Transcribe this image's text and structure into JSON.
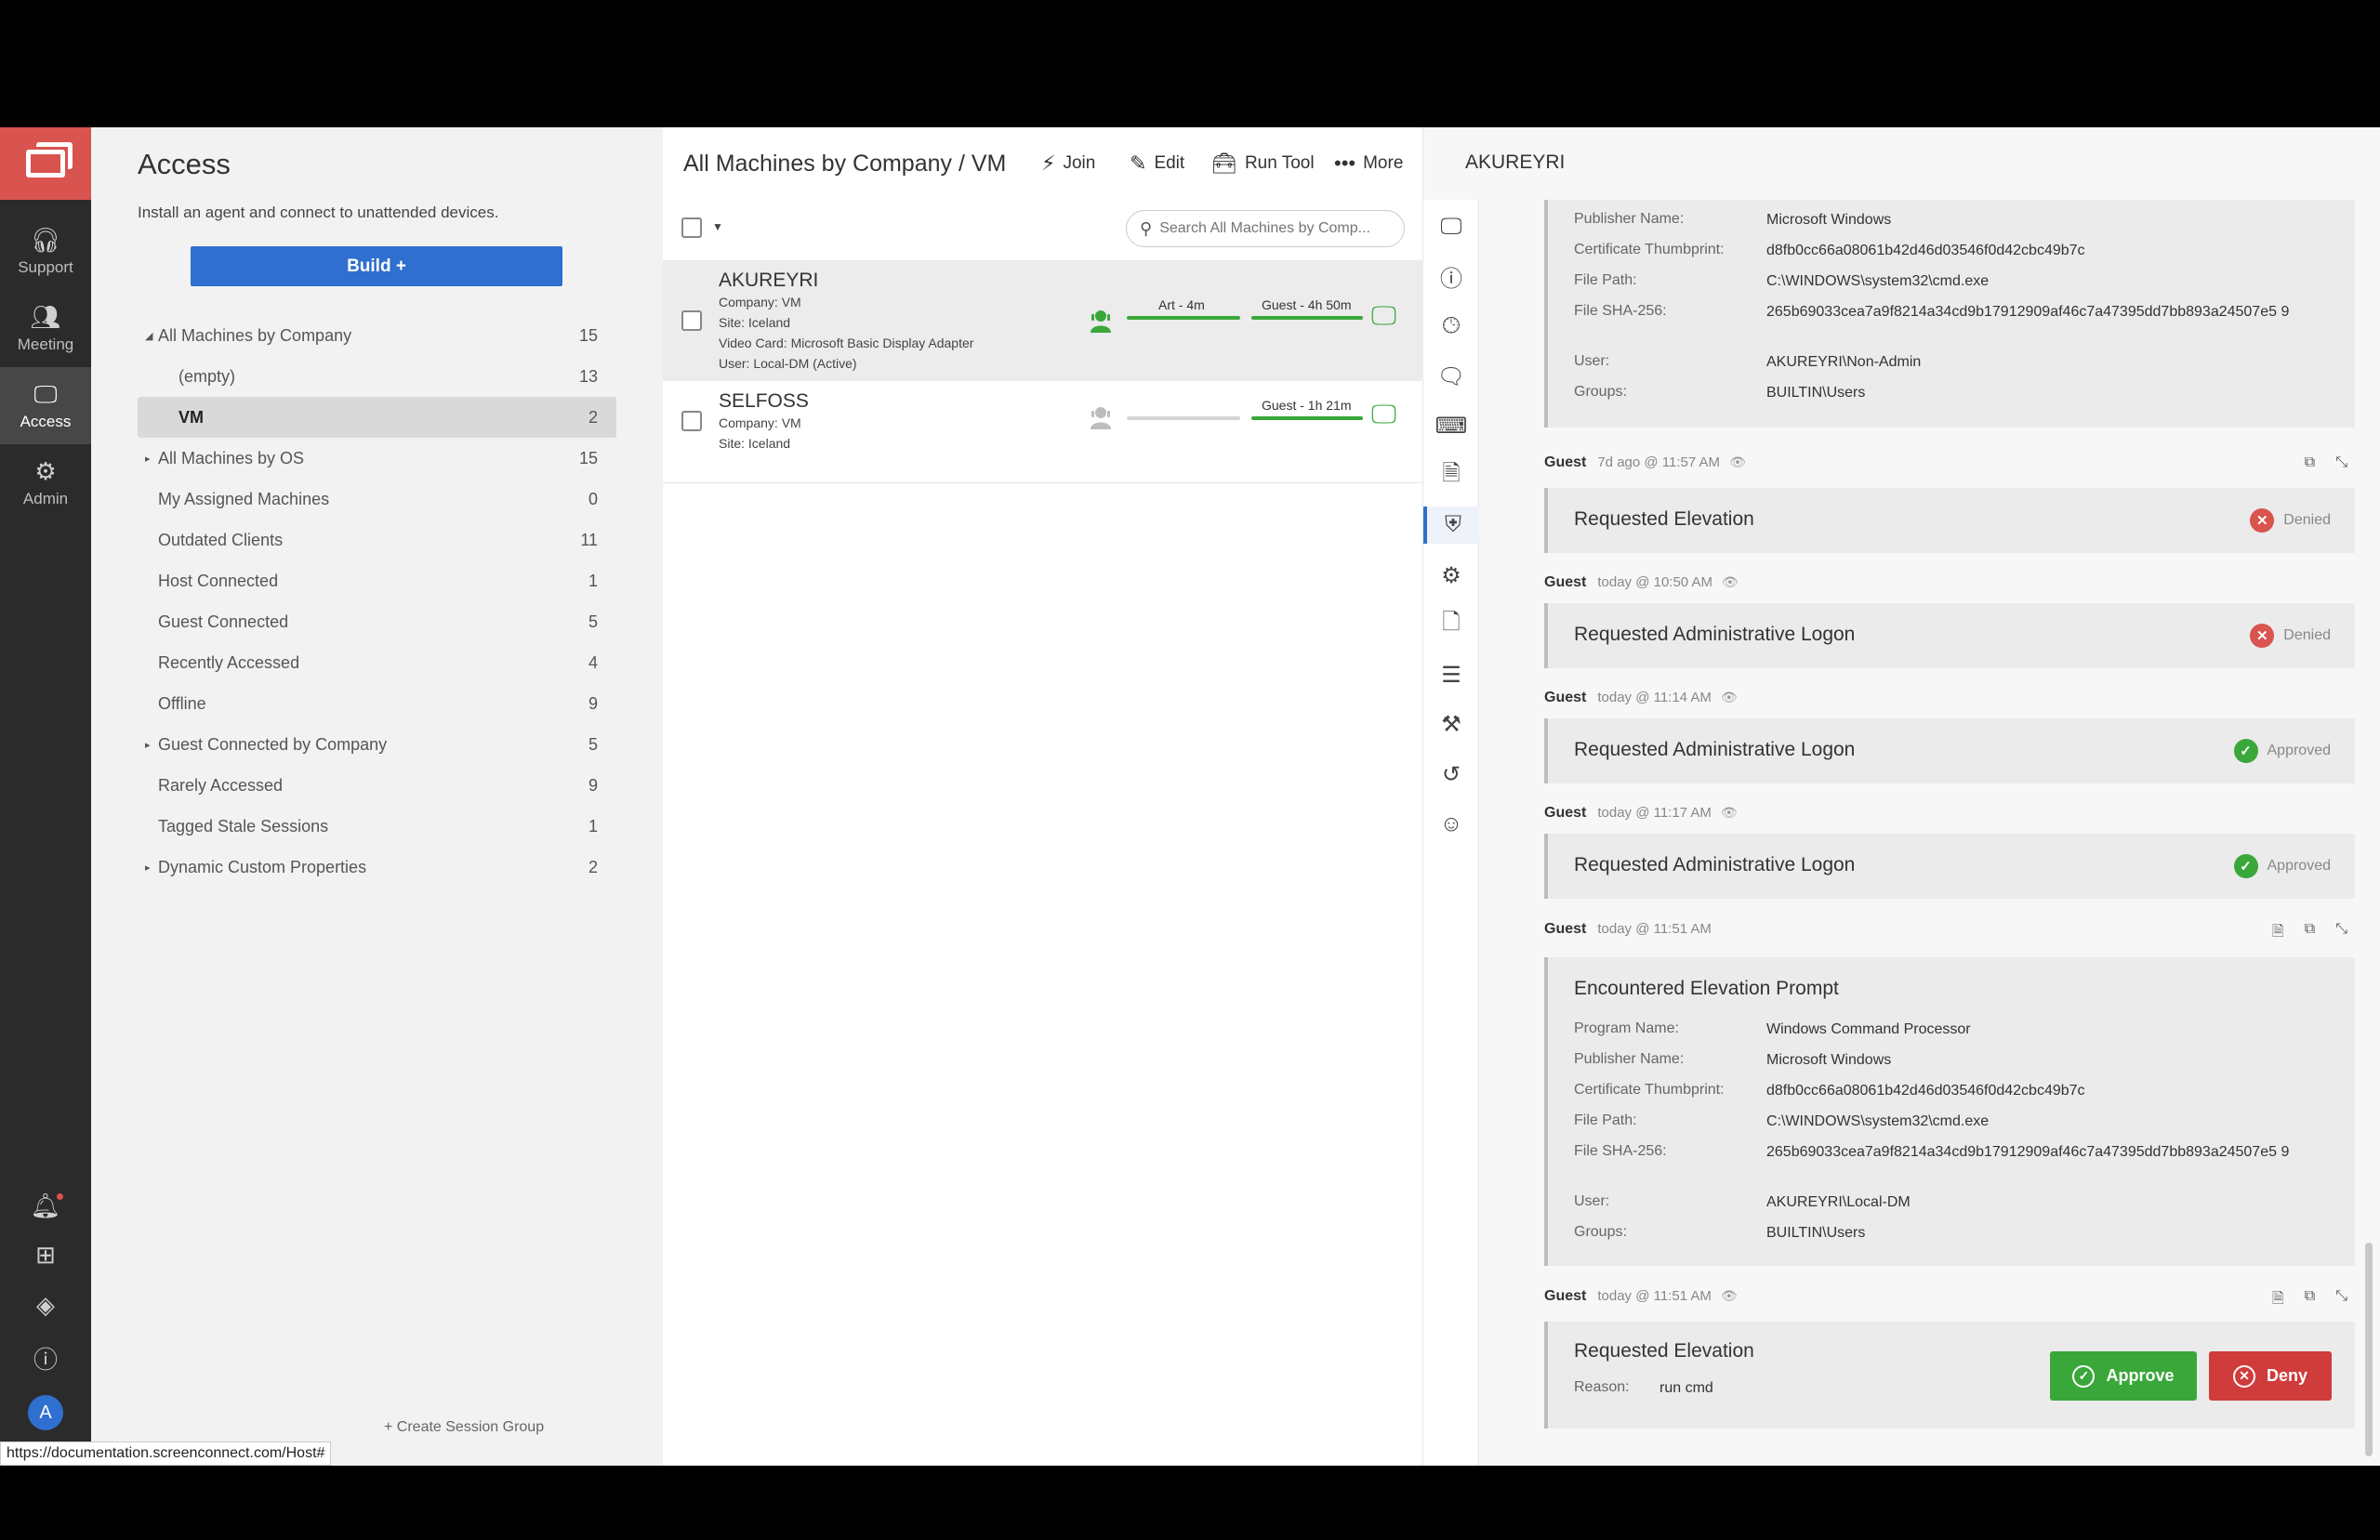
{
  "rail": {
    "items": [
      {
        "label": "Support",
        "icon": "headset-icon"
      },
      {
        "label": "Meeting",
        "icon": "people-icon"
      },
      {
        "label": "Access",
        "icon": "monitor-icon"
      },
      {
        "label": "Admin",
        "icon": "gear-icon"
      }
    ],
    "avatar_initial": "A"
  },
  "groups": {
    "title": "Access",
    "subtitle": "Install an agent and connect to unattended devices.",
    "build_label": "Build +",
    "items": [
      {
        "label": "All Machines by Company",
        "count": "15",
        "caret": "◢"
      },
      {
        "label": "(empty)",
        "count": "13"
      },
      {
        "label": "VM",
        "count": "2"
      },
      {
        "label": "All Machines by OS",
        "count": "15",
        "caret": "▸"
      },
      {
        "label": "My Assigned Machines",
        "count": "0"
      },
      {
        "label": "Outdated Clients",
        "count": "11"
      },
      {
        "label": "Host Connected",
        "count": "1"
      },
      {
        "label": "Guest Connected",
        "count": "5"
      },
      {
        "label": "Recently Accessed",
        "count": "4"
      },
      {
        "label": "Offline",
        "count": "9"
      },
      {
        "label": "Guest Connected by Company",
        "count": "5",
        "caret": "▸"
      },
      {
        "label": "Rarely Accessed",
        "count": "9"
      },
      {
        "label": "Tagged Stale Sessions",
        "count": "1"
      },
      {
        "label": "Dynamic Custom Properties",
        "count": "2",
        "caret": "▸"
      }
    ],
    "create_label": "+ Create Session Group"
  },
  "machines": {
    "title": "All Machines by Company / VM",
    "toolbar": {
      "join": "Join",
      "edit": "Edit",
      "run_tool": "Run Tool",
      "more": "More"
    },
    "search_placeholder": "Search All Machines by Comp...",
    "rows": [
      {
        "name": "AKUREYRI",
        "details": [
          "Company: VM",
          "Site: Iceland",
          "Video Card: Microsoft Basic Display Adapter",
          "User: Local-DM (Active)"
        ],
        "host_label": "Art - 4m",
        "guest_label": "Guest - 4h 50m"
      },
      {
        "name": "SELFOSS",
        "details": [
          "Company: VM",
          "Site: Iceland"
        ],
        "guest_label": "Guest - 1h 21m"
      }
    ]
  },
  "detail": {
    "title": "AKUREYRI",
    "top_card": {
      "rows": [
        {
          "k": "Publisher Name:",
          "v": "Microsoft Windows"
        },
        {
          "k": "Certificate Thumbprint:",
          "v": "d8fb0cc66a08061b42d46d03546f0d42cbc49b7c"
        },
        {
          "k": "File Path:",
          "v": "C:\\WINDOWS\\system32\\cmd.exe"
        },
        {
          "k": "File SHA-256:",
          "v": "265b69033cea7a9f8214a34cd9b17912909af46c7a47395dd7bb893a24507e5 9"
        },
        {
          "k": "User:",
          "v": "AKUREYRI\\Non-Admin"
        },
        {
          "k": "Groups:",
          "v": "BUILTIN\\Users"
        }
      ]
    },
    "events": [
      {
        "who": "Guest",
        "when": "7d ago @ 11:57 AM",
        "title": "Requested Elevation",
        "status": "Denied"
      },
      {
        "who": "Guest",
        "when": "today @ 10:50 AM",
        "title": "Requested Administrative Logon",
        "status": "Denied"
      },
      {
        "who": "Guest",
        "when": "today @ 11:14 AM",
        "title": "Requested Administrative Logon",
        "status": "Approved"
      },
      {
        "who": "Guest",
        "when": "today @ 11:17 AM",
        "title": "Requested Administrative Logon",
        "status": "Approved"
      }
    ],
    "prompt_event": {
      "who": "Guest",
      "when": "today @ 11:51 AM",
      "title": "Encountered Elevation Prompt",
      "rows": [
        {
          "k": "Program Name:",
          "v": "Windows Command Processor"
        },
        {
          "k": "Publisher Name:",
          "v": "Microsoft Windows"
        },
        {
          "k": "Certificate Thumbprint:",
          "v": "d8fb0cc66a08061b42d46d03546f0d42cbc49b7c"
        },
        {
          "k": "File Path:",
          "v": "C:\\WINDOWS\\system32\\cmd.exe"
        },
        {
          "k": "File SHA-256:",
          "v": "265b69033cea7a9f8214a34cd9b17912909af46c7a47395dd7bb893a24507e5 9"
        },
        {
          "k": "User:",
          "v": "AKUREYRI\\Local-DM"
        },
        {
          "k": "Groups:",
          "v": "BUILTIN\\Users"
        }
      ]
    },
    "request_event": {
      "who": "Guest",
      "when": "today @ 11:51 AM",
      "title": "Requested Elevation",
      "reason_label": "Reason:",
      "reason_value": "run cmd",
      "approve_label": "Approve",
      "deny_label": "Deny"
    }
  },
  "status_url": "https://documentation.screenconnect.com/Host#",
  "colors": {
    "accent": "#2f6fcf",
    "brand": "#d9534f",
    "approve": "#3aa73a",
    "deny": "#d03b3b"
  }
}
